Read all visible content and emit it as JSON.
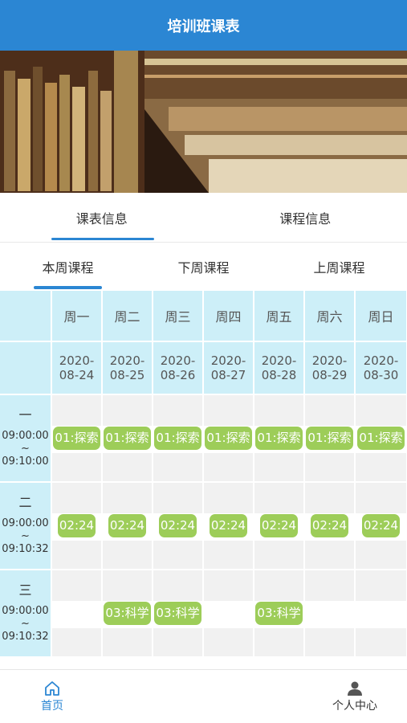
{
  "header": {
    "title": "培训班课表"
  },
  "banner": {
    "description": ""
  },
  "tabs_primary": [
    {
      "label": "课表信息",
      "active": true
    },
    {
      "label": "课程信息",
      "active": false
    }
  ],
  "tabs_week": [
    {
      "label": "本周课程",
      "active": true
    },
    {
      "label": "下周课程",
      "active": false
    },
    {
      "label": "上周课程",
      "active": false
    }
  ],
  "schedule": {
    "weekdays": [
      "周一",
      "周二",
      "周三",
      "周四",
      "周五",
      "周六",
      "周日"
    ],
    "dates": [
      [
        "2020-",
        "08-24"
      ],
      [
        "2020-",
        "08-25"
      ],
      [
        "2020-",
        "08-26"
      ],
      [
        "2020-",
        "08-27"
      ],
      [
        "2020-",
        "08-28"
      ],
      [
        "2020-",
        "08-29"
      ],
      [
        "2020-",
        "08-30"
      ]
    ],
    "slots": [
      {
        "num": "一",
        "start": "09:00:00",
        "sep": "~",
        "end": "09:10:00",
        "courses": [
          "01:探索",
          "01:探索",
          "01:探索",
          "01:探索",
          "01:探索",
          "01:探索",
          "01:探索"
        ]
      },
      {
        "num": "二",
        "start": "09:00:00",
        "sep": "~",
        "end": "09:10:32",
        "courses": [
          "02:24",
          "02:24",
          "02:24",
          "02:24",
          "02:24",
          "02:24",
          "02:24"
        ]
      },
      {
        "num": "三",
        "start": "09:00:00",
        "sep": "~",
        "end": "09:10:32",
        "courses": [
          "",
          "03:科学",
          "03:科学",
          "",
          "03:科学",
          "",
          ""
        ]
      }
    ]
  },
  "bottom_nav": {
    "home": "首页",
    "me": "个人中心"
  },
  "colors": {
    "primary": "#2b86d3",
    "header_cell": "#cdeff8",
    "course_badge": "#9dcd59"
  }
}
